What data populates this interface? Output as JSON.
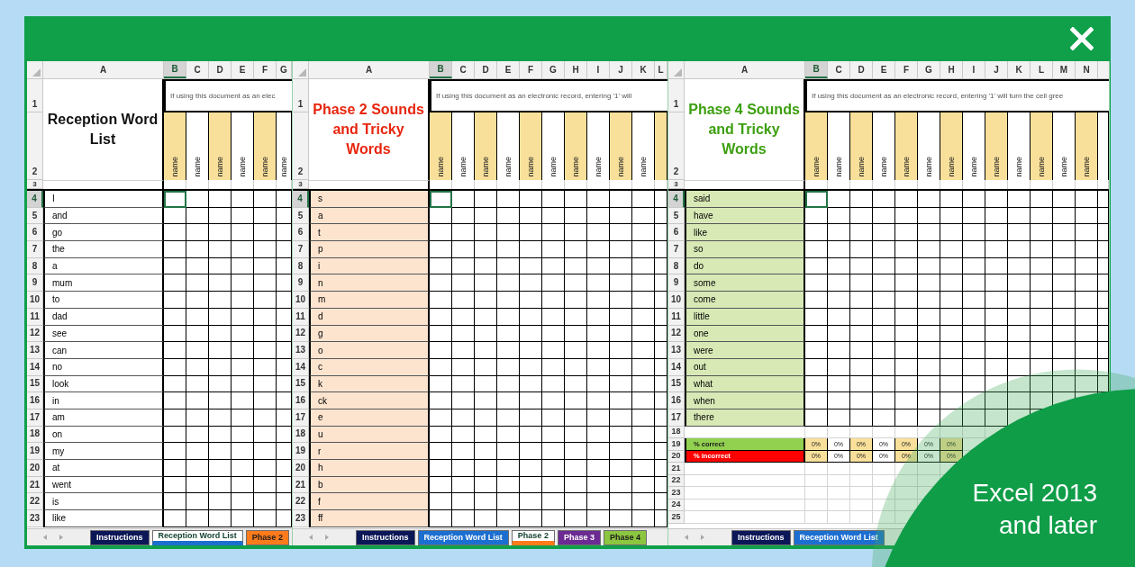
{
  "sheets": [
    {
      "title": {
        "text": "Reception Word List",
        "color": "#111111"
      },
      "note": "If using this document as an elec",
      "word_column": {
        "color": "#ffffff"
      },
      "header_rows": [
        "1",
        "2",
        "3"
      ],
      "columns": [
        {
          "label": "A",
          "selected": false
        },
        {
          "label": "B",
          "selected": true,
          "name": "name",
          "color": "#f8e09a"
        },
        {
          "label": "C",
          "selected": false,
          "name": "name",
          "color": "#ffffff"
        },
        {
          "label": "D",
          "selected": false,
          "name": "name",
          "color": "#f8e09a"
        },
        {
          "label": "E",
          "selected": false,
          "name": "name",
          "color": "#ffffff"
        },
        {
          "label": "F",
          "selected": false,
          "name": "name",
          "color": "#f8e09a"
        },
        {
          "label": "G",
          "selected": false,
          "name": "name",
          "color": "#ffffff"
        }
      ],
      "rows": [
        {
          "kind": "word",
          "number": "4",
          "selected": true,
          "word": "I"
        },
        {
          "kind": "word",
          "number": "5",
          "selected": false,
          "word": "and"
        },
        {
          "kind": "word",
          "number": "6",
          "selected": false,
          "word": "go"
        },
        {
          "kind": "word",
          "number": "7",
          "selected": false,
          "word": "the"
        },
        {
          "kind": "word",
          "number": "8",
          "selected": false,
          "word": "a"
        },
        {
          "kind": "word",
          "number": "9",
          "selected": false,
          "word": "mum"
        },
        {
          "kind": "word",
          "number": "10",
          "selected": false,
          "word": "to"
        },
        {
          "kind": "word",
          "number": "11",
          "selected": false,
          "word": "dad"
        },
        {
          "kind": "word",
          "number": "12",
          "selected": false,
          "word": "see"
        },
        {
          "kind": "word",
          "number": "13",
          "selected": false,
          "word": "can"
        },
        {
          "kind": "word",
          "number": "14",
          "selected": false,
          "word": "no"
        },
        {
          "kind": "word",
          "number": "15",
          "selected": false,
          "word": "look"
        },
        {
          "kind": "word",
          "number": "16",
          "selected": false,
          "word": "in"
        },
        {
          "kind": "word",
          "number": "17",
          "selected": false,
          "word": "am"
        },
        {
          "kind": "word",
          "number": "18",
          "selected": false,
          "word": "on"
        },
        {
          "kind": "word",
          "number": "19",
          "selected": false,
          "word": "my"
        },
        {
          "kind": "word",
          "number": "20",
          "selected": false,
          "word": "at"
        },
        {
          "kind": "word",
          "number": "21",
          "selected": false,
          "word": "went"
        },
        {
          "kind": "word",
          "number": "22",
          "selected": false,
          "word": "is"
        },
        {
          "kind": "word",
          "number": "23",
          "selected": false,
          "word": "like"
        }
      ],
      "tabs": [
        {
          "label": "Instructions",
          "color": "#0b1757",
          "selected": false
        },
        {
          "label": "Reception Word List",
          "color": "#1c6fd1",
          "selected": true
        },
        {
          "label": "Phase 2",
          "color": "#ff7b1c",
          "selected": false
        }
      ]
    },
    {
      "title": {
        "text": "Phase 2 Sounds and Tricky Words",
        "color": "#e8250d"
      },
      "note": "If using this document as an electronic record, entering '1' will",
      "word_column": {
        "color": "#fde4cf"
      },
      "header_rows": [
        "1",
        "2",
        "3"
      ],
      "columns": [
        {
          "label": "A",
          "selected": false
        },
        {
          "label": "B",
          "selected": true,
          "name": "name",
          "color": "#f8e09a"
        },
        {
          "label": "C",
          "selected": false,
          "name": "name",
          "color": "#ffffff"
        },
        {
          "label": "D",
          "selected": false,
          "name": "name",
          "color": "#f8e09a"
        },
        {
          "label": "E",
          "selected": false,
          "name": "name",
          "color": "#ffffff"
        },
        {
          "label": "F",
          "selected": false,
          "name": "name",
          "color": "#f8e09a"
        },
        {
          "label": "G",
          "selected": false,
          "name": "name",
          "color": "#ffffff"
        },
        {
          "label": "H",
          "selected": false,
          "name": "name",
          "color": "#f8e09a"
        },
        {
          "label": "I",
          "selected": false,
          "name": "name",
          "color": "#ffffff"
        },
        {
          "label": "J",
          "selected": false,
          "name": "name",
          "color": "#f8e09a"
        },
        {
          "label": "K",
          "selected": false,
          "name": "name",
          "color": "#ffffff"
        },
        {
          "label": "L",
          "selected": false,
          "color": "#f8e09a"
        }
      ],
      "rows": [
        {
          "kind": "word",
          "number": "4",
          "selected": true,
          "word": "s"
        },
        {
          "kind": "word",
          "number": "5",
          "selected": false,
          "word": "a"
        },
        {
          "kind": "word",
          "number": "6",
          "selected": false,
          "word": "t"
        },
        {
          "kind": "word",
          "number": "7",
          "selected": false,
          "word": "p"
        },
        {
          "kind": "word",
          "number": "8",
          "selected": false,
          "word": "i"
        },
        {
          "kind": "word",
          "number": "9",
          "selected": false,
          "word": "n"
        },
        {
          "kind": "word",
          "number": "10",
          "selected": false,
          "word": "m"
        },
        {
          "kind": "word",
          "number": "11",
          "selected": false,
          "word": "d"
        },
        {
          "kind": "word",
          "number": "12",
          "selected": false,
          "word": "g"
        },
        {
          "kind": "word",
          "number": "13",
          "selected": false,
          "word": "o"
        },
        {
          "kind": "word",
          "number": "14",
          "selected": false,
          "word": "c"
        },
        {
          "kind": "word",
          "number": "15",
          "selected": false,
          "word": "k"
        },
        {
          "kind": "word",
          "number": "16",
          "selected": false,
          "word": "ck"
        },
        {
          "kind": "word",
          "number": "17",
          "selected": false,
          "word": "e"
        },
        {
          "kind": "word",
          "number": "18",
          "selected": false,
          "word": "u"
        },
        {
          "kind": "word",
          "number": "19",
          "selected": false,
          "word": "r"
        },
        {
          "kind": "word",
          "number": "20",
          "selected": false,
          "word": "h"
        },
        {
          "kind": "word",
          "number": "21",
          "selected": false,
          "word": "b"
        },
        {
          "kind": "word",
          "number": "22",
          "selected": false,
          "word": "f"
        },
        {
          "kind": "word",
          "number": "23",
          "selected": false,
          "word": "ff"
        }
      ],
      "tabs": [
        {
          "label": "Instructions",
          "color": "#0b1757",
          "selected": false
        },
        {
          "label": "Reception Word List",
          "color": "#1c6fd1",
          "selected": false
        },
        {
          "label": "Phase 2",
          "color": "#ff7b1c",
          "selected": true
        },
        {
          "label": "Phase 3",
          "color": "#6c2a93",
          "selected": false
        },
        {
          "label": "Phase 4",
          "color": "#8cc540",
          "selected": false
        }
      ]
    },
    {
      "title": {
        "text": "Phase 4 Sounds and Tricky Words",
        "color": "#3c9f0f"
      },
      "note": "If using this document as an electronic record, entering '1' will turn the cell gree",
      "word_column": {
        "color": "#d8e9b6"
      },
      "header_rows": [
        "1",
        "2",
        "3"
      ],
      "columns": [
        {
          "label": "A",
          "selected": false
        },
        {
          "label": "B",
          "selected": true,
          "name": "name",
          "color": "#f8e09a"
        },
        {
          "label": "C",
          "selected": false,
          "name": "name",
          "color": "#ffffff"
        },
        {
          "label": "D",
          "selected": false,
          "name": "name",
          "color": "#f8e09a"
        },
        {
          "label": "E",
          "selected": false,
          "name": "name",
          "color": "#ffffff"
        },
        {
          "label": "F",
          "selected": false,
          "name": "name",
          "color": "#f8e09a"
        },
        {
          "label": "G",
          "selected": false,
          "name": "name",
          "color": "#ffffff"
        },
        {
          "label": "H",
          "selected": false,
          "name": "name",
          "color": "#f8e09a"
        },
        {
          "label": "I",
          "selected": false,
          "name": "name",
          "color": "#ffffff"
        },
        {
          "label": "J",
          "selected": false,
          "name": "name",
          "color": "#f8e09a"
        },
        {
          "label": "K",
          "selected": false,
          "name": "name",
          "color": "#ffffff"
        },
        {
          "label": "L",
          "selected": false,
          "name": "name",
          "color": "#f8e09a"
        },
        {
          "label": "M",
          "selected": false,
          "name": "name",
          "color": "#ffffff"
        },
        {
          "label": "N",
          "selected": false,
          "name": "name",
          "color": "#f8e09a"
        },
        {
          "color": "#ffffff"
        }
      ],
      "rows": [
        {
          "kind": "word",
          "number": "4",
          "selected": true,
          "word": "said"
        },
        {
          "kind": "word",
          "number": "5",
          "selected": false,
          "word": "have"
        },
        {
          "kind": "word",
          "number": "6",
          "selected": false,
          "word": "like"
        },
        {
          "kind": "word",
          "number": "7",
          "selected": false,
          "word": "so"
        },
        {
          "kind": "word",
          "number": "8",
          "selected": false,
          "word": "do"
        },
        {
          "kind": "word",
          "number": "9",
          "selected": false,
          "word": "some"
        },
        {
          "kind": "word",
          "number": "10",
          "selected": false,
          "word": "come"
        },
        {
          "kind": "word",
          "number": "11",
          "selected": false,
          "word": "little"
        },
        {
          "kind": "word",
          "number": "12",
          "selected": false,
          "word": "one"
        },
        {
          "kind": "word",
          "number": "13",
          "selected": false,
          "word": "were"
        },
        {
          "kind": "word",
          "number": "14",
          "selected": false,
          "word": "out"
        },
        {
          "kind": "word",
          "number": "15",
          "selected": false,
          "word": "what"
        },
        {
          "kind": "word",
          "number": "16",
          "selected": false,
          "word": "when"
        },
        {
          "kind": "word",
          "number": "17",
          "selected": false,
          "word": "there"
        },
        {
          "kind": "blank",
          "number": "18",
          "selected": false
        },
        {
          "kind": "summary",
          "number": "19",
          "selected": false,
          "label": "% correct",
          "color": "#92d050",
          "values": [
            "0%",
            "0%",
            "0%",
            "0%",
            "0%",
            "0%",
            "0%"
          ]
        },
        {
          "kind": "summary",
          "number": "20",
          "selected": false,
          "label": "% incorrect",
          "color": "#ff0000",
          "values": [
            "0%",
            "0%",
            "0%",
            "0%",
            "0%",
            "0%",
            "0%"
          ]
        },
        {
          "kind": "blank",
          "number": "21",
          "selected": false
        },
        {
          "kind": "blank",
          "number": "22",
          "selected": false
        },
        {
          "kind": "blank",
          "number": "23",
          "selected": false
        },
        {
          "kind": "blank",
          "number": "24",
          "selected": false
        },
        {
          "kind": "blank",
          "number": "25",
          "selected": false
        }
      ],
      "tabs": [
        {
          "label": "Instructions",
          "color": "#0b1757",
          "selected": false
        },
        {
          "label": "Reception Word List",
          "color": "#1c6fd1",
          "selected": false
        }
      ]
    }
  ],
  "badge": {
    "text": "Excel 2013 and later"
  }
}
